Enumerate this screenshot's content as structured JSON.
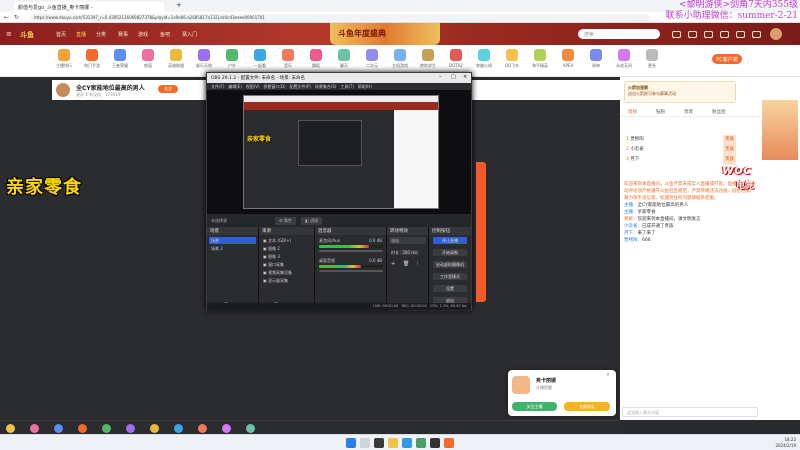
{
  "browser": {
    "tab_title": "颜值与爱go_斗鱼直播_奥卡丽娜 -",
    "url": "https://www.douyu.com/531397_r=0.43952116069827378&playId=1e9e06-a2685817e1321dc0c43eeee00001701"
  },
  "overlay": {
    "line1": "<黎明游侠>剑角7天内355级",
    "line2": "联系小助理微信：summer-2-21"
  },
  "nav": {
    "logo": "斗鱼",
    "items": [
      "首页",
      "直播",
      "分类",
      "赛事",
      "游戏",
      "鱼吧",
      "猜入门"
    ],
    "banner": "斗鱼年度盛典",
    "search_placeholder": "搜索"
  },
  "categories": [
    "主播排行",
    "热门手游",
    "王者荣耀",
    "颜值",
    "英雄联盟",
    "娱乐天地",
    "户外",
    "一起看",
    "音乐",
    "舞蹈",
    "聊天",
    "二次元",
    "主机游戏",
    "绝地求生",
    "DOTA2",
    "穿越火线",
    "QQ飞车",
    "和平精英",
    "APEX",
    "原神",
    "永劫无间",
    "更多"
  ],
  "pc_button": "PC客户端",
  "room": {
    "title": "全CY家能地位最高的男人",
    "meta": "虎牙 4 刘汉风",
    "fans": "173519",
    "follow_label": "关注"
  },
  "caption": "亲家零食",
  "obs": {
    "title": "OBS 29.1.2 - 配置文件: 未命名 - 场景: 未命名",
    "menu": [
      "文件(F)",
      "编辑(E)",
      "视图(V)",
      "停靠窗口(D)",
      "配置文件(P)",
      "场景集合(S)",
      "工具(T)",
      "帮助(H)"
    ],
    "inner_caption": "亲家零食",
    "scene_label": "未选择源",
    "props_btn": "属性",
    "filter_btn": "滤镜",
    "docks": {
      "scenes": {
        "title": "场景",
        "items": [
          "场景",
          "场景 2"
        ]
      },
      "sources": {
        "title": "来源",
        "items": [
          "文本 (GDI+)",
          "图像 2",
          "图像 3",
          "窗口采集",
          "视频采集设备",
          "显示器采集"
        ]
      },
      "mixer": {
        "title": "混音器",
        "items": [
          "麦克风/Aux",
          "桌面音频"
        ],
        "levels": [
          "0.0 dB",
          "0.0 dB"
        ],
        "fill": [
          0.78,
          0.66
        ]
      },
      "transitions": {
        "title": "转场特效",
        "mode": "淡出",
        "duration_label": "时长",
        "duration": "300 ms"
      },
      "controls": {
        "title": "控制按钮",
        "buttons": [
          "停止直播",
          "开始录制",
          "启动虚拟摄像机",
          "工作室模式",
          "设置",
          "退出"
        ]
      }
    },
    "status": {
      "live": "LIVE: 00:00:00",
      "rec": "REC: 00:00:00",
      "cpu": "CPU: 1.3%, 60.00 fps"
    }
  },
  "chat": {
    "promo_title": "火箭加速赛",
    "promo_text": "送出火箭即可参与赛事活动",
    "tabs": [
      "周榜",
      "钻粉",
      "贵宾",
      "粉丝团"
    ],
    "ranks": [
      {
        "rank": "1",
        "name": "贾熙阳",
        "badge": "贵族"
      },
      {
        "rank": "2",
        "name": "小云雀",
        "badge": "贵族"
      },
      {
        "rank": "3",
        "name": "月下",
        "badge": "贵族"
      }
    ],
    "notice": "欢迎来到本直播间，斗鱼严禁未成年人直播或打赏。直播内容和互动评论须严格遵守斗鱼社区规范，严禁传播违法违规、低俗色情、暴力等不良信息。如遇到任何问题请联系客服。",
    "messages": [
      {
        "user": "主播：",
        "text": "全CY家能地位最高的男人"
      },
      {
        "user": "主播：",
        "text": "亲家零食"
      },
      {
        "user": "系统：",
        "text": "欢迎来到本直播间，请文明发言"
      },
      {
        "user": "小云雀：",
        "text": "已成开通了贵族"
      },
      {
        "user": "月下：",
        "text": "来了来了"
      },
      {
        "user": "贾熙阳：",
        "text": "666"
      }
    ],
    "input_placeholder": "这里输入聊天内容"
  },
  "woc": {
    "top": "woc",
    "bottom": "电竞"
  },
  "gift_popup": {
    "title": "奥卡丽娜",
    "subtitle": "开播提醒",
    "btn_left": "关注主播",
    "btn_right": "立即送礼"
  },
  "clock": {
    "time": "18:22",
    "date": "2024/2/19"
  }
}
